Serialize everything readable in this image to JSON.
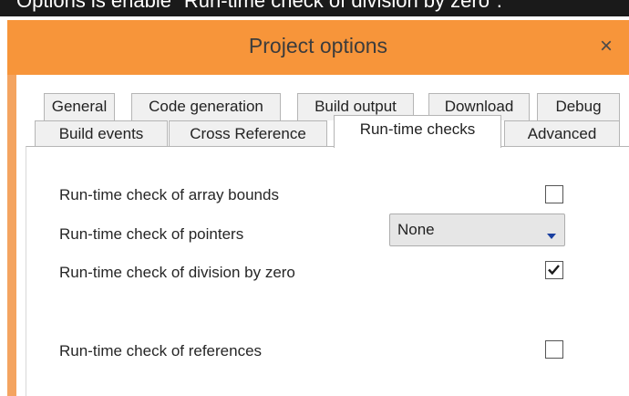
{
  "caption": "Options is enable \"Run-time check of division by zero\".",
  "dialog": {
    "title": "Project options",
    "close_glyph": "×"
  },
  "tabs": {
    "row_back": [
      "General",
      "Code generation",
      "Build output",
      "Download",
      "Debug"
    ],
    "row_front": [
      "Build events",
      "Cross Reference",
      "Run-time checks",
      "Advanced"
    ],
    "active": "Run-time checks"
  },
  "options": [
    {
      "label": "Run-time check of array bounds",
      "control": "checkbox",
      "checked": false
    },
    {
      "label": "Run-time check of pointers",
      "control": "select",
      "value": "None"
    },
    {
      "label": "Run-time check of division by zero",
      "control": "checkbox",
      "checked": true
    },
    {
      "label": "Run-time check of references",
      "control": "checkbox",
      "checked": false
    }
  ],
  "colors": {
    "titlebar": "#f7953a",
    "dialog_border": "#f4a460",
    "select_arrow": "#1a3fa0"
  },
  "icons": {
    "close": "close-icon",
    "checkmark": "checkmark-icon",
    "dropdown": "chevron-down-icon"
  }
}
